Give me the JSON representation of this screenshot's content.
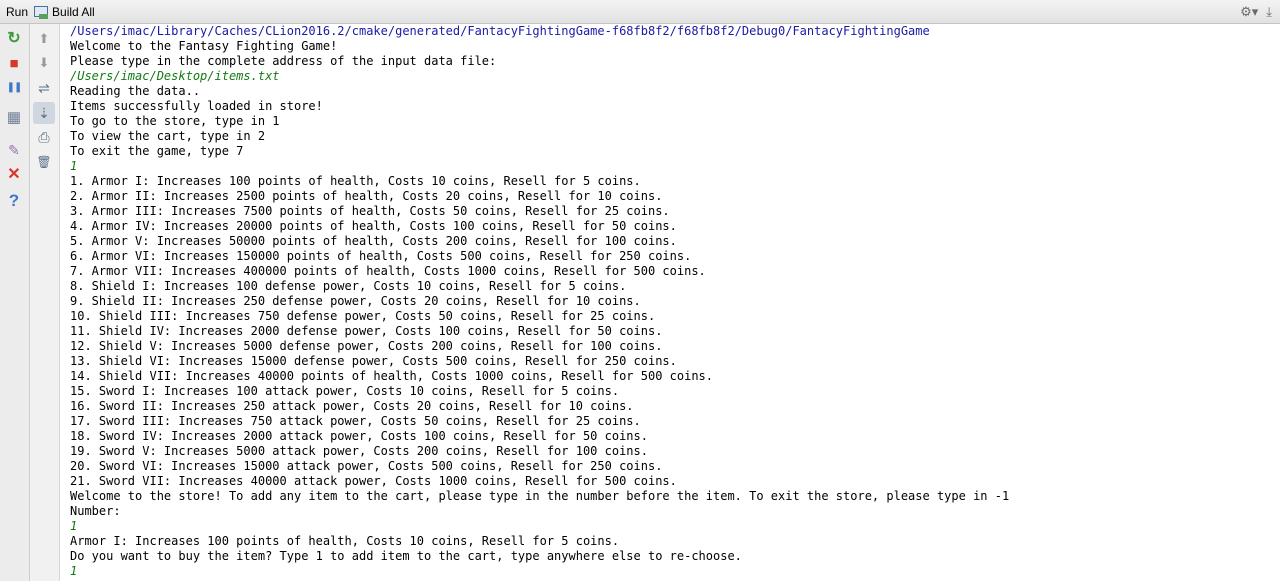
{
  "toolbar": {
    "run_label": "Run",
    "config_label": "Build All",
    "settings_icon": "gear-icon",
    "hide_icon": "hide-panel-icon"
  },
  "left_tools": [
    {
      "name": "rerun-icon",
      "glyph": "↻",
      "color": "#3d9b3d"
    },
    {
      "name": "stop-icon",
      "glyph": "■",
      "color": "#d9352b"
    },
    {
      "name": "pause-icon",
      "glyph": "❚❚",
      "color": "#3d78c9"
    },
    {
      "name": "layout-icon",
      "glyph": "▦",
      "color": "#6b7c93"
    },
    {
      "name": "pin-icon",
      "glyph": "✎",
      "color": "#9a6fb0"
    },
    {
      "name": "close-icon",
      "glyph": "✕",
      "color": "#d9352b"
    },
    {
      "name": "help-icon",
      "glyph": "?",
      "color": "#3d78c9"
    }
  ],
  "right_tools": [
    {
      "name": "arrow-up-icon",
      "glyph": "⬆",
      "color": "#9a9a9a"
    },
    {
      "name": "arrow-down-icon",
      "glyph": "⬇",
      "color": "#9a9a9a"
    },
    {
      "name": "soft-wrap-icon",
      "glyph": "⇌",
      "color": "#5a6f86"
    },
    {
      "name": "scroll-to-end-icon",
      "glyph": "⇣",
      "color": "#5a6f86"
    },
    {
      "name": "print-icon",
      "glyph": "⎙",
      "color": "#5a6f86"
    },
    {
      "name": "trash-icon",
      "glyph": "🗑",
      "color": "#5a6f86"
    }
  ],
  "console": [
    {
      "text": "/Users/imac/Library/Caches/CLion2016.2/cmake/generated/FantacyFightingGame-f68fb8f2/f68fb8f2/Debug0/FantacyFightingGame",
      "type": "path"
    },
    {
      "text": "Welcome to the Fantasy Fighting Game!",
      "type": "out"
    },
    {
      "text": "Please type in the complete address of the input data file:",
      "type": "out"
    },
    {
      "text": "/Users/imac/Desktop/items.txt",
      "type": "input"
    },
    {
      "text": "Reading the data..",
      "type": "out"
    },
    {
      "text": "Items successfully loaded in store!",
      "type": "out"
    },
    {
      "text": "To go to the store, type in 1",
      "type": "out"
    },
    {
      "text": "To view the cart, type in 2",
      "type": "out"
    },
    {
      "text": "To exit the game, type 7",
      "type": "out"
    },
    {
      "text": "1",
      "type": "input"
    },
    {
      "text": "1. Armor I: Increases 100 points of health, Costs 10 coins, Resell for 5 coins.",
      "type": "out"
    },
    {
      "text": "2. Armor II: Increases 2500 points of health, Costs 20 coins, Resell for 10 coins.",
      "type": "out"
    },
    {
      "text": "3. Armor III: Increases 7500 points of health, Costs 50 coins, Resell for 25 coins.",
      "type": "out"
    },
    {
      "text": "4. Armor IV: Increases 20000 points of health, Costs 100 coins, Resell for 50 coins.",
      "type": "out"
    },
    {
      "text": "5. Armor V: Increases 50000 points of health, Costs 200 coins, Resell for 100 coins.",
      "type": "out"
    },
    {
      "text": "6. Armor VI: Increases 150000 points of health, Costs 500 coins, Resell for 250 coins.",
      "type": "out"
    },
    {
      "text": "7. Armor VII: Increases 400000 points of health, Costs 1000 coins, Resell for 500 coins.",
      "type": "out"
    },
    {
      "text": "8. Shield I: Increases 100 defense power, Costs 10 coins, Resell for 5 coins.",
      "type": "out"
    },
    {
      "text": "9. Shield II: Increases 250 defense power, Costs 20 coins, Resell for 10 coins.",
      "type": "out"
    },
    {
      "text": "10. Shield III: Increases 750 defense power, Costs 50 coins, Resell for 25 coins.",
      "type": "out"
    },
    {
      "text": "11. Shield IV: Increases 2000 defense power, Costs 100 coins, Resell for 50 coins.",
      "type": "out"
    },
    {
      "text": "12. Shield V: Increases 5000 defense power, Costs 200 coins, Resell for 100 coins.",
      "type": "out"
    },
    {
      "text": "13. Shield VI: Increases 15000 defense power, Costs 500 coins, Resell for 250 coins.",
      "type": "out"
    },
    {
      "text": "14. Shield VII: Increases 40000 points of health, Costs 1000 coins, Resell for 500 coins.",
      "type": "out"
    },
    {
      "text": "15. Sword I: Increases 100 attack power, Costs 10 coins, Resell for 5 coins.",
      "type": "out"
    },
    {
      "text": "16. Sword II: Increases 250 attack power, Costs 20 coins, Resell for 10 coins.",
      "type": "out"
    },
    {
      "text": "17. Sword III: Increases 750 attack power, Costs 50 coins, Resell for 25 coins.",
      "type": "out"
    },
    {
      "text": "18. Sword IV: Increases 2000 attack power, Costs 100 coins, Resell for 50 coins.",
      "type": "out"
    },
    {
      "text": "19. Sword V: Increases 5000 attack power, Costs 200 coins, Resell for 100 coins.",
      "type": "out"
    },
    {
      "text": "20. Sword VI: Increases 15000 attack power, Costs 500 coins, Resell for 250 coins.",
      "type": "out"
    },
    {
      "text": "21. Sword VII: Increases 40000 attack power, Costs 1000 coins, Resell for 500 coins.",
      "type": "out"
    },
    {
      "text": "Welcome to the store! To add any item to the cart, please type in the number before the item. To exit the store, please type in -1",
      "type": "out"
    },
    {
      "text": "Number:",
      "type": "out"
    },
    {
      "text": "1",
      "type": "input"
    },
    {
      "text": "Armor I: Increases 100 points of health, Costs 10 coins, Resell for 5 coins.",
      "type": "out"
    },
    {
      "text": "Do you want to buy the item? Type 1 to add item to the cart, type anywhere else to re-choose.",
      "type": "out"
    },
    {
      "text": "1",
      "type": "input"
    }
  ]
}
